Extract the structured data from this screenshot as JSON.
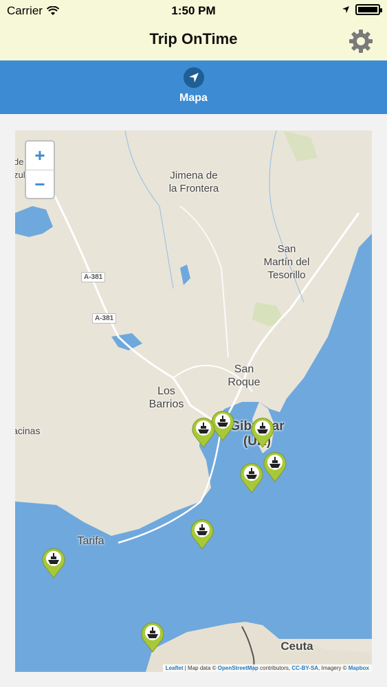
{
  "status": {
    "carrier": "Carrier",
    "time": "1:50 PM"
  },
  "header": {
    "title": "Trip OnTime"
  },
  "tabs": [
    {
      "label": "Mapa"
    }
  ],
  "map": {
    "zoom_in": "+",
    "zoom_out": "−",
    "places": {
      "jimena": "Jimena de la Frontera",
      "san_martin": "San Martín del Tesorillo",
      "san_roque": "San Roque",
      "los_barrios": "Los Barrios",
      "gibraltar": "Gibraltar (UK)",
      "tarifa": "Tarifa",
      "ceuta": "Ceuta",
      "facinas": "acinas",
      "edge": "de zul"
    },
    "roads": [
      "A-381",
      "A-381"
    ],
    "attribution": {
      "leaflet": "Leaflet",
      "map_data": "| Map data ©",
      "osm": "OpenStreetMap",
      "contributors": "contributors,",
      "license": "CC-BY-SA",
      "imagery": ", Imagery ©",
      "mapbox": "Mapbox"
    },
    "marker_icon": "ship-icon",
    "colors": {
      "sea": "#6fa8dc",
      "land": "#e9e4d8",
      "marker": "#a8c83a",
      "accent": "#3d8bd2"
    }
  }
}
